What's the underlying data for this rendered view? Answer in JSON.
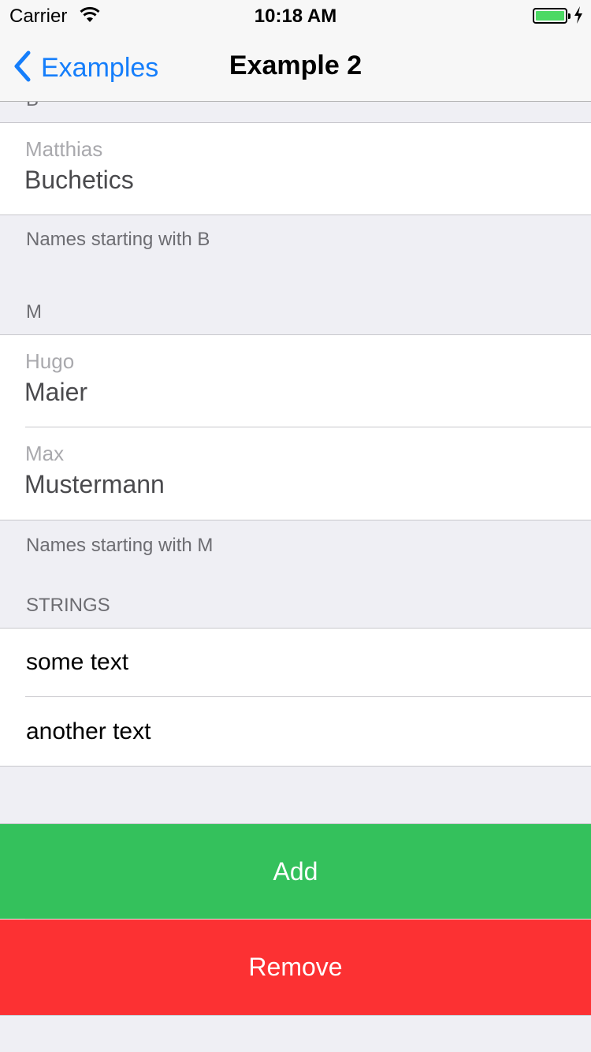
{
  "status_bar": {
    "carrier": "Carrier",
    "time": "10:18 AM"
  },
  "nav_bar": {
    "back_label": "Examples",
    "title": "Example 2"
  },
  "sections": [
    {
      "header": "B",
      "rows": [
        {
          "subtitle": "Matthias",
          "text": "Buchetics"
        }
      ],
      "footer": "Names starting with B"
    },
    {
      "header": "M",
      "rows": [
        {
          "subtitle": "Hugo",
          "text": "Maier"
        },
        {
          "subtitle": "Max",
          "text": "Mustermann"
        }
      ],
      "footer": "Names starting with M"
    },
    {
      "header": "STRINGS",
      "rows": [
        {
          "text": "some text"
        },
        {
          "text": "another text"
        }
      ]
    }
  ],
  "buttons": {
    "add": {
      "label": "Add",
      "color": "#34c15c"
    },
    "remove": {
      "label": "Remove",
      "color": "#fc3133"
    }
  },
  "colors": {
    "accent": "#157efb",
    "background": "#efeff4"
  }
}
